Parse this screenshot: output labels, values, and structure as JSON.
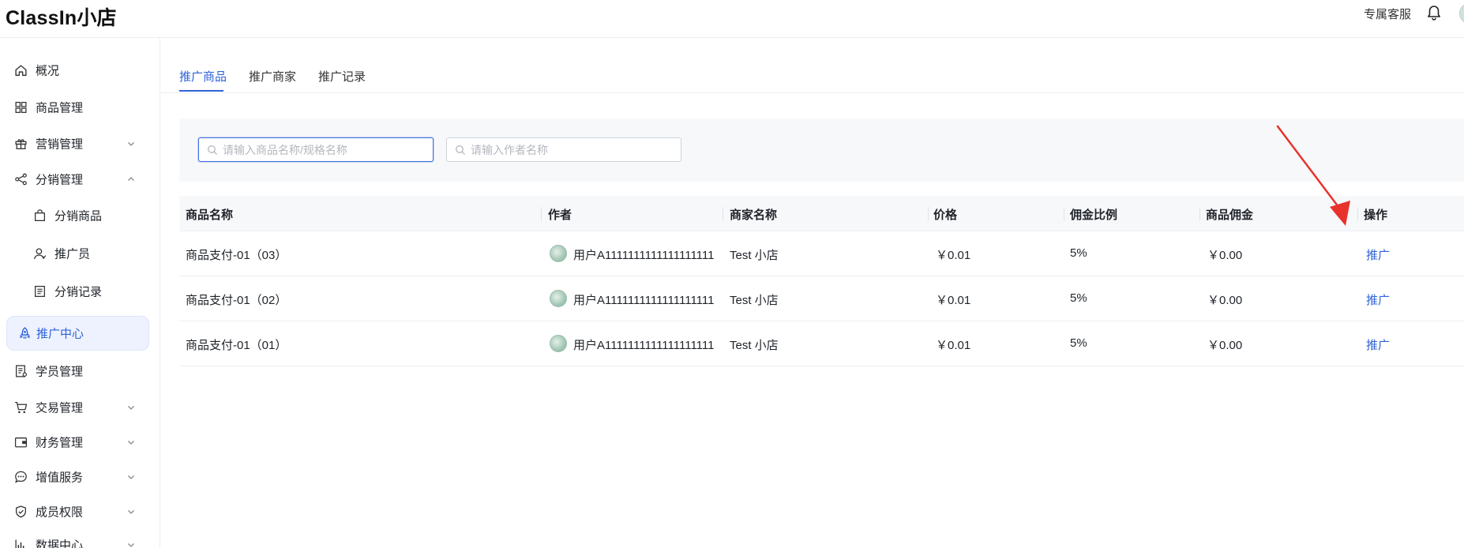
{
  "header": {
    "brand": "ClassIn小店",
    "support_label": "专属客服",
    "bell_icon": "bell-icon",
    "avatar_icon": "avatar"
  },
  "sidebar": {
    "items": [
      {
        "label": "概况",
        "icon": "home-icon"
      },
      {
        "label": "商品管理",
        "icon": "grid-icon"
      },
      {
        "label": "营销管理",
        "icon": "gift-icon",
        "chevron": "down"
      },
      {
        "label": "分销管理",
        "icon": "share-icon",
        "chevron": "up"
      },
      {
        "label": "分销商品",
        "icon": "bag-icon",
        "sub": true
      },
      {
        "label": "推广员",
        "icon": "user-icon",
        "sub": true
      },
      {
        "label": "分销记录",
        "icon": "record-icon",
        "sub": true
      },
      {
        "label": "推广中心",
        "icon": "rocket-icon",
        "active": true
      },
      {
        "label": "学员管理",
        "icon": "student-icon"
      },
      {
        "label": "交易管理",
        "icon": "cart-icon",
        "chevron": "down"
      },
      {
        "label": "财务管理",
        "icon": "wallet-icon",
        "chevron": "down"
      },
      {
        "label": "增值服务",
        "icon": "chat-icon",
        "chevron": "down"
      },
      {
        "label": "成员权限",
        "icon": "shield-icon",
        "chevron": "down"
      },
      {
        "label": "数据中心",
        "icon": "chart-icon",
        "chevron": "down"
      }
    ]
  },
  "tabs": [
    {
      "label": "推广商品",
      "active": true
    },
    {
      "label": "推广商家"
    },
    {
      "label": "推广记录"
    }
  ],
  "filters": {
    "product_search": {
      "placeholder": "请输入商品名称/规格名称",
      "value": ""
    },
    "author_search": {
      "placeholder": "请输入作者名称",
      "value": ""
    }
  },
  "table": {
    "columns": [
      "商品名称",
      "作者",
      "商家名称",
      "价格",
      "佣金比例",
      "商品佣金",
      "操作"
    ],
    "rows": [
      {
        "name": "商品支付-01（03）",
        "author": "用户A1111111111111111111",
        "shop": "Test 小店",
        "price": "￥0.01",
        "ratio": "5%",
        "commission": "￥0.00",
        "action": "推广"
      },
      {
        "name": "商品支付-01（02）",
        "author": "用户A1111111111111111111",
        "shop": "Test 小店",
        "price": "￥0.01",
        "ratio": "5%",
        "commission": "￥0.00",
        "action": "推广"
      },
      {
        "name": "商品支付-01（01）",
        "author": "用户A1111111111111111111",
        "shop": "Test 小店",
        "price": "￥0.01",
        "ratio": "5%",
        "commission": "￥0.00",
        "action": "推广"
      }
    ]
  },
  "colors": {
    "accent": "#2f62d9",
    "annotation_arrow": "#e8332c"
  }
}
